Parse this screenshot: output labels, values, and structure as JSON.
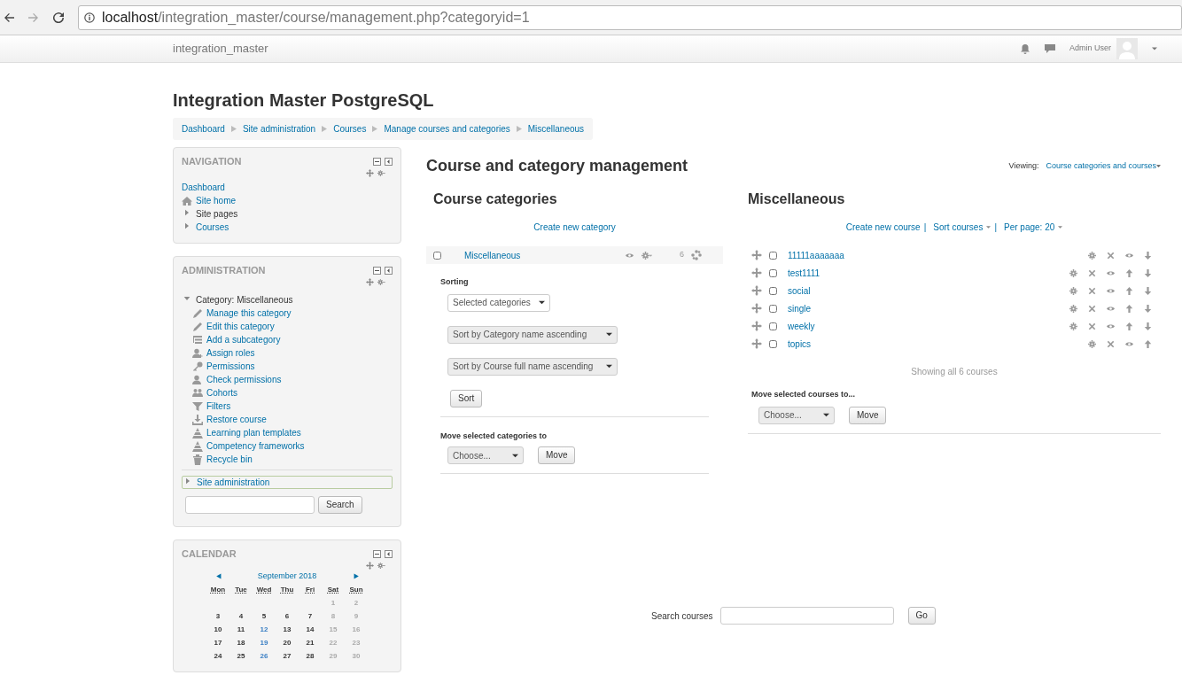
{
  "browser": {
    "url_host": "localhost",
    "url_path": "/integration_master/course/management.php?categoryid=1"
  },
  "navbar": {
    "site_name": "integration_master",
    "user_name": "Admin User"
  },
  "page_title": "Integration Master PostgreSQL",
  "breadcrumb": [
    "Dashboard",
    "Site administration",
    "Courses",
    "Manage courses and categories",
    "Miscellaneous"
  ],
  "navigation": {
    "title": "NAVIGATION",
    "items": [
      {
        "label": "Dashboard",
        "kind": "link"
      },
      {
        "label": "Site home",
        "kind": "home"
      },
      {
        "label": "Site pages",
        "kind": "branch",
        "expanded": false
      },
      {
        "label": "Courses",
        "kind": "branch-link",
        "expanded": false
      }
    ]
  },
  "administration": {
    "title": "ADMINISTRATION",
    "items": [
      {
        "label": "Category: Miscellaneous",
        "expanded": true,
        "selected": false,
        "children": [
          "Manage this category",
          "Edit this category",
          "Add a subcategory",
          "Assign roles",
          "Permissions",
          "Check permissions",
          "Cohorts",
          "Filters",
          "Restore course",
          "Learning plan templates",
          "Competency frameworks",
          "Recycle bin"
        ]
      },
      {
        "label": "Site administration",
        "expanded": false,
        "selected": true
      }
    ],
    "search_button": "Search"
  },
  "calendar": {
    "title": "CALENDAR",
    "month": "September 2018",
    "weekdays": [
      "Mon",
      "Tue",
      "Wed",
      "Thu",
      "Fri",
      "Sat",
      "Sun"
    ],
    "weeks": [
      [
        {
          "day": "1",
          "kind": "weekend"
        },
        {
          "day": "2",
          "kind": "weekend"
        }
      ],
      [
        {
          "day": "3",
          "kind": "day"
        },
        {
          "day": "4",
          "kind": "day"
        },
        {
          "day": "5",
          "kind": "day"
        },
        {
          "day": "6",
          "kind": "day"
        },
        {
          "day": "7",
          "kind": "day"
        },
        {
          "day": "8",
          "kind": "weekend"
        },
        {
          "day": "9",
          "kind": "weekend"
        }
      ],
      [
        {
          "day": "10",
          "kind": "day"
        },
        {
          "day": "11",
          "kind": "day"
        },
        {
          "day": "12",
          "kind": "event"
        },
        {
          "day": "13",
          "kind": "day"
        },
        {
          "day": "14",
          "kind": "day"
        },
        {
          "day": "15",
          "kind": "weekend"
        },
        {
          "day": "16",
          "kind": "weekend"
        }
      ],
      [
        {
          "day": "17",
          "kind": "day"
        },
        {
          "day": "18",
          "kind": "day"
        },
        {
          "day": "19",
          "kind": "event"
        },
        {
          "day": "20",
          "kind": "day"
        },
        {
          "day": "21",
          "kind": "day"
        },
        {
          "day": "22",
          "kind": "weekend"
        },
        {
          "day": "23",
          "kind": "weekend"
        }
      ],
      [
        {
          "day": "24",
          "kind": "day"
        },
        {
          "day": "25",
          "kind": "day"
        },
        {
          "day": "26",
          "kind": "event"
        },
        {
          "day": "27",
          "kind": "day"
        },
        {
          "day": "28",
          "kind": "day"
        },
        {
          "day": "29",
          "kind": "weekend"
        },
        {
          "day": "30",
          "kind": "weekend"
        }
      ]
    ]
  },
  "heading": "Course and category management",
  "viewing": {
    "label": "Viewing:",
    "value": "Course categories and courses"
  },
  "categories": {
    "title": "Course categories",
    "create_link": "Create new category",
    "items": [
      {
        "name": "Miscellaneous",
        "checked": false,
        "count": "6"
      }
    ],
    "sorting_label": "Sorting",
    "sort_selects": [
      "Selected categories",
      "Sort by Category name ascending",
      "Sort by Course full name ascending"
    ],
    "sort_button": "Sort",
    "move_label": "Move selected categories to",
    "move_select": "Choose...",
    "move_button": "Move"
  },
  "courses": {
    "title": "Miscellaneous",
    "actions": [
      {
        "label": "Create new course",
        "kind": "link"
      },
      {
        "label": "|",
        "kind": "separator"
      },
      {
        "label": "Sort courses",
        "kind": "menu"
      },
      {
        "label": "|",
        "kind": "separator"
      },
      {
        "label": "Per page: 20",
        "kind": "menu"
      }
    ],
    "items": [
      {
        "name": "11111aaaaaaa",
        "checked": false,
        "can_move_up": false,
        "can_move_down": true
      },
      {
        "name": "test1111",
        "checked": false,
        "can_move_up": true,
        "can_move_down": true
      },
      {
        "name": "social",
        "checked": false,
        "can_move_up": true,
        "can_move_down": true
      },
      {
        "name": "single",
        "checked": false,
        "can_move_up": true,
        "can_move_down": true
      },
      {
        "name": "weekly",
        "checked": false,
        "can_move_up": true,
        "can_move_down": true
      },
      {
        "name": "topics",
        "checked": false,
        "can_move_up": true,
        "can_move_down": false
      }
    ],
    "summary": "Showing all 6 courses",
    "move_label": "Move selected courses to...",
    "move_select": "Choose...",
    "move_button": "Move"
  },
  "search": {
    "label": "Search courses",
    "button": "Go"
  }
}
